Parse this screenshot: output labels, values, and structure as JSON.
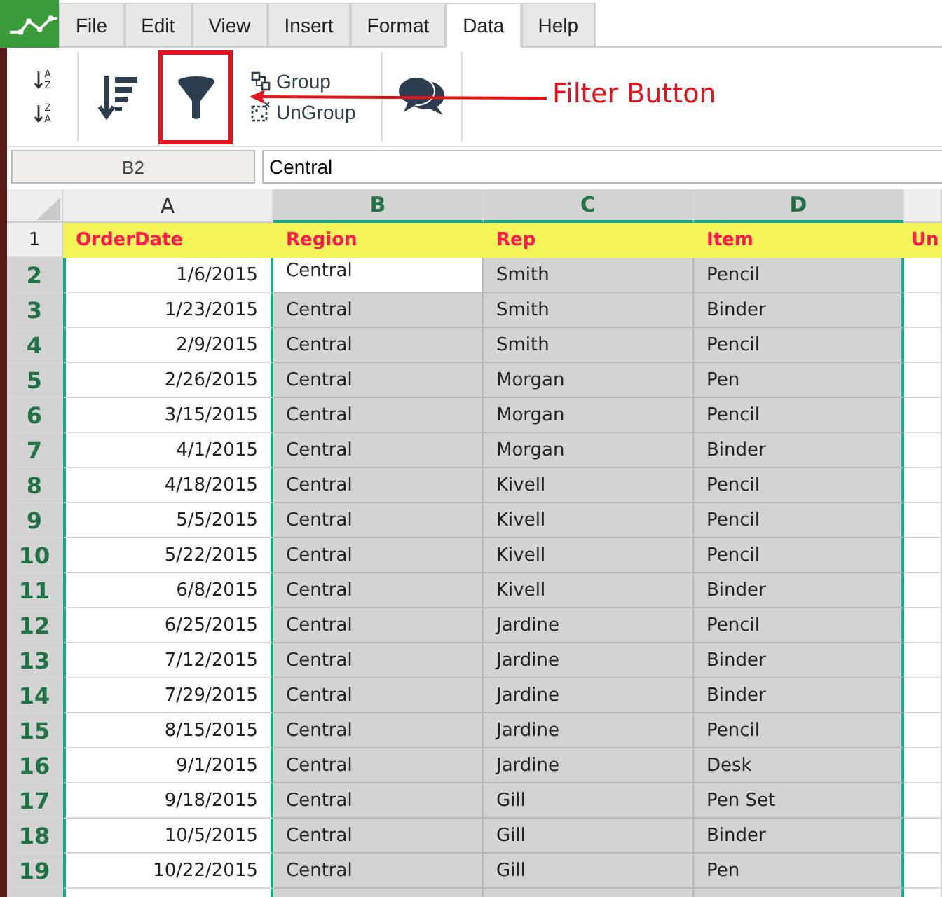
{
  "menu": [
    {
      "label": "File",
      "selected": false
    },
    {
      "label": "Edit",
      "selected": false
    },
    {
      "label": "View",
      "selected": false
    },
    {
      "label": "Insert",
      "selected": false
    },
    {
      "label": "Format",
      "selected": false
    },
    {
      "label": "Data",
      "selected": true
    },
    {
      "label": "Help",
      "selected": false
    }
  ],
  "ribbon": {
    "sort_ascending": {
      "top": "A",
      "bottom": "Z"
    },
    "sort_descending": {
      "top": "Z",
      "bottom": "A"
    },
    "group": "Group",
    "ungroup": "UnGroup"
  },
  "annotation": {
    "label": "Filter Button"
  },
  "formula_bar": {
    "cell": "B2",
    "value": "Central"
  },
  "columns": [
    {
      "label": "A",
      "selected": false
    },
    {
      "label": "B",
      "selected": true
    },
    {
      "label": "C",
      "selected": true
    },
    {
      "label": "D",
      "selected": true
    }
  ],
  "rows": [
    {
      "header": "1",
      "kind": "heading",
      "selected": false,
      "active": false,
      "cells": [
        "OrderDate",
        "Region",
        "Rep",
        "Item",
        "Un"
      ]
    },
    {
      "header": "2",
      "kind": "data",
      "selected": true,
      "active": true,
      "cells": [
        "1/6/2015",
        "Central",
        "Smith",
        "Pencil"
      ]
    },
    {
      "header": "3",
      "kind": "data",
      "selected": true,
      "active": false,
      "cells": [
        "1/23/2015",
        "Central",
        "Smith",
        "Binder"
      ]
    },
    {
      "header": "4",
      "kind": "data",
      "selected": true,
      "active": false,
      "cells": [
        "2/9/2015",
        "Central",
        "Smith",
        "Pencil"
      ]
    },
    {
      "header": "5",
      "kind": "data",
      "selected": true,
      "active": false,
      "cells": [
        "2/26/2015",
        "Central",
        "Morgan",
        "Pen"
      ]
    },
    {
      "header": "6",
      "kind": "data",
      "selected": true,
      "active": false,
      "cells": [
        "3/15/2015",
        "Central",
        "Morgan",
        "Pencil"
      ]
    },
    {
      "header": "7",
      "kind": "data",
      "selected": true,
      "active": false,
      "cells": [
        "4/1/2015",
        "Central",
        "Morgan",
        "Binder"
      ]
    },
    {
      "header": "8",
      "kind": "data",
      "selected": true,
      "active": false,
      "cells": [
        "4/18/2015",
        "Central",
        "Kivell",
        "Pencil"
      ]
    },
    {
      "header": "9",
      "kind": "data",
      "selected": true,
      "active": false,
      "cells": [
        "5/5/2015",
        "Central",
        "Kivell",
        "Pencil"
      ]
    },
    {
      "header": "10",
      "kind": "data",
      "selected": true,
      "active": false,
      "cells": [
        "5/22/2015",
        "Central",
        "Kivell",
        "Pencil"
      ]
    },
    {
      "header": "11",
      "kind": "data",
      "selected": true,
      "active": false,
      "cells": [
        "6/8/2015",
        "Central",
        "Kivell",
        "Binder"
      ]
    },
    {
      "header": "12",
      "kind": "data",
      "selected": true,
      "active": false,
      "cells": [
        "6/25/2015",
        "Central",
        "Jardine",
        "Pencil"
      ]
    },
    {
      "header": "13",
      "kind": "data",
      "selected": true,
      "active": false,
      "cells": [
        "7/12/2015",
        "Central",
        "Jardine",
        "Binder"
      ]
    },
    {
      "header": "14",
      "kind": "data",
      "selected": true,
      "active": false,
      "cells": [
        "7/29/2015",
        "Central",
        "Jardine",
        "Binder"
      ]
    },
    {
      "header": "15",
      "kind": "data",
      "selected": true,
      "active": false,
      "cells": [
        "8/15/2015",
        "Central",
        "Jardine",
        "Pencil"
      ]
    },
    {
      "header": "16",
      "kind": "data",
      "selected": true,
      "active": false,
      "cells": [
        "9/1/2015",
        "Central",
        "Jardine",
        "Desk"
      ]
    },
    {
      "header": "17",
      "kind": "data",
      "selected": true,
      "active": false,
      "cells": [
        "9/18/2015",
        "Central",
        "Gill",
        "Pen Set"
      ]
    },
    {
      "header": "18",
      "kind": "data",
      "selected": true,
      "active": false,
      "cells": [
        "10/5/2015",
        "Central",
        "Gill",
        "Binder"
      ]
    },
    {
      "header": "19",
      "kind": "data",
      "selected": true,
      "active": false,
      "cells": [
        "10/22/2015",
        "Central",
        "Gill",
        "Pen"
      ]
    }
  ]
}
